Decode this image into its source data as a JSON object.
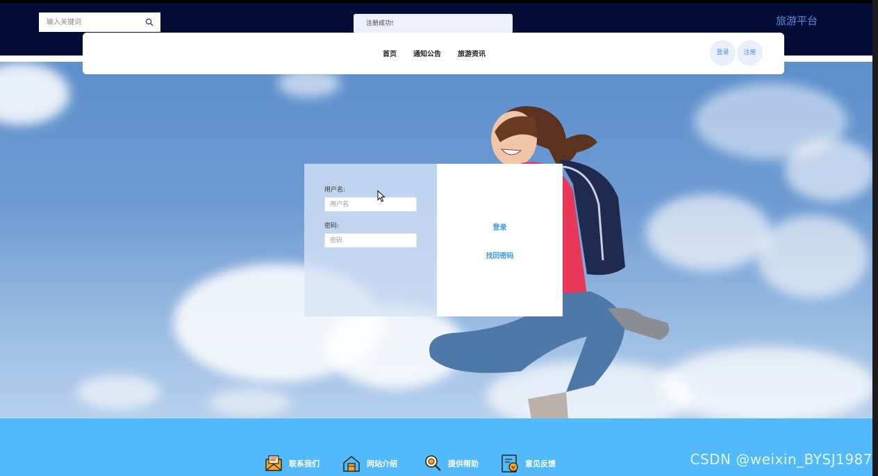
{
  "header": {
    "search": {
      "placeholder": "输入关键词"
    },
    "toast": "注册成功!",
    "brand": "旅游平台"
  },
  "nav": {
    "items": [
      "首页",
      "通知公告",
      "旅游资讯"
    ],
    "login": "登录",
    "register": "注册"
  },
  "login_form": {
    "username_label": "用户名:",
    "username_placeholder": "用户名",
    "password_label": "密码:",
    "password_placeholder": "密码",
    "login_action": "登录",
    "forgot_action": "找回密码"
  },
  "footer": {
    "items": [
      "联系我们",
      "网站介绍",
      "提供帮助",
      "意见反馈"
    ]
  },
  "watermark": "CSDN @weixin_BYSJ1987",
  "colors": {
    "topbar": "#020c34",
    "brand": "#4f8fe0",
    "link": "#3c9be8",
    "footer": "#52b9fb"
  },
  "icons": [
    "search-icon",
    "mail-icon",
    "home-icon",
    "help-icon",
    "feedback-icon"
  ]
}
